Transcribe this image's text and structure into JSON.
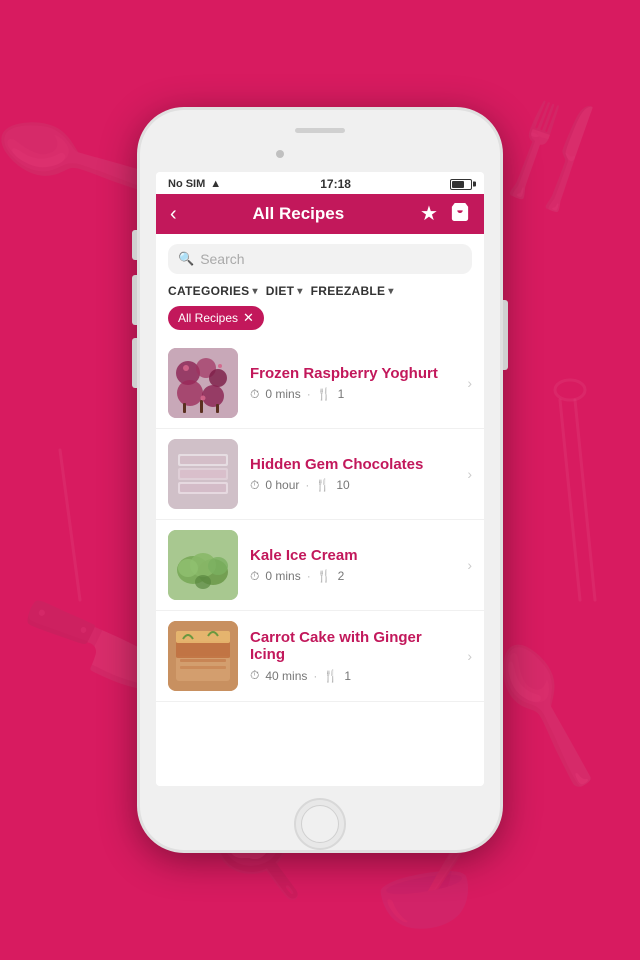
{
  "status": {
    "carrier": "No SIM",
    "time": "17:18",
    "wifi": "📶"
  },
  "header": {
    "title": "All Recipes",
    "back_label": "‹",
    "favorite_label": "★",
    "cart_label": "🛒"
  },
  "search": {
    "placeholder": "Search"
  },
  "filters": {
    "categories_label": "CATEGORIES",
    "diet_label": "DIET",
    "freezable_label": "FREEZABLE"
  },
  "active_filter": {
    "label": "All Recipes",
    "close": "✕"
  },
  "recipes": [
    {
      "name": "Frozen Raspberry Yoghurt",
      "time": "0 mins",
      "servings": "1",
      "thumb_type": "raspberry"
    },
    {
      "name": "Hidden Gem Chocolates",
      "time": "0 hour",
      "servings": "10",
      "thumb_type": "chocolate"
    },
    {
      "name": "Kale Ice Cream",
      "time": "0 mins",
      "servings": "2",
      "thumb_type": "kale"
    },
    {
      "name": "Carrot Cake with Ginger Icing",
      "time": "40 mins",
      "servings": "1",
      "thumb_type": "carrot"
    }
  ],
  "icons": {
    "clock": "⏱",
    "cutlery": "🍴",
    "chevron_right": "›",
    "chevron_down": "⌄",
    "search": "🔍"
  },
  "colors": {
    "brand": "#c2185b",
    "bg": "#d81b60"
  }
}
